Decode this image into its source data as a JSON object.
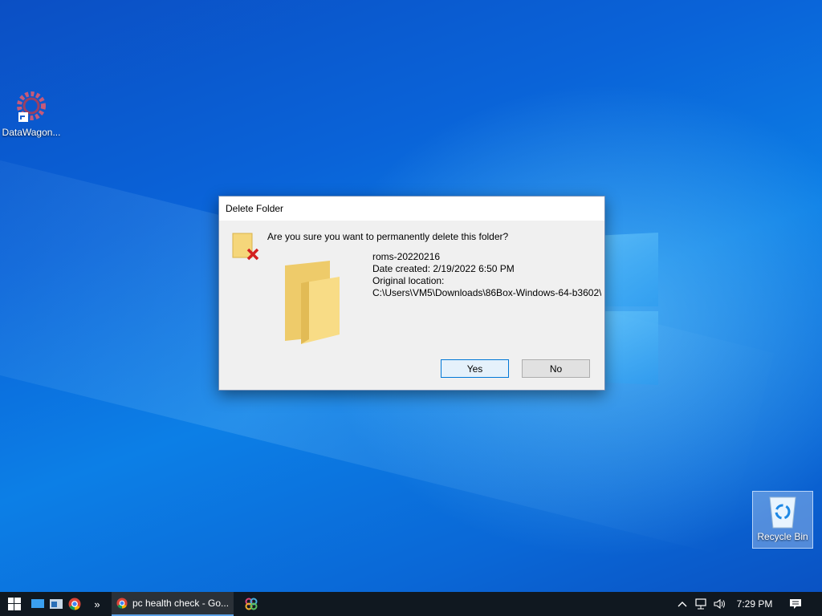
{
  "desktop": {
    "icons": [
      {
        "label": "DataWagon...",
        "icon": "gear-shortcut-icon"
      },
      {
        "label": "Recycle Bin",
        "icon": "recycle-bin-icon"
      }
    ]
  },
  "dialog": {
    "title": "Delete Folder",
    "message": "Are you sure you want to permanently delete this folder?",
    "folder_name": "roms-20220216",
    "date_created": "Date created: 2/19/2022 6:50 PM",
    "original_location_label": "Original location:",
    "original_location": "C:\\Users\\VM5\\Downloads\\86Box-Windows-64-b3602\\",
    "yes_label": "Yes",
    "no_label": "No"
  },
  "taskbar": {
    "chevron": "»",
    "active_task": "pc health check - Go...",
    "clock": "7:29 PM"
  },
  "colors": {
    "accent": "#0078d7",
    "taskbar_bg": "#101820",
    "dialog_bg": "#f0f0f0"
  }
}
